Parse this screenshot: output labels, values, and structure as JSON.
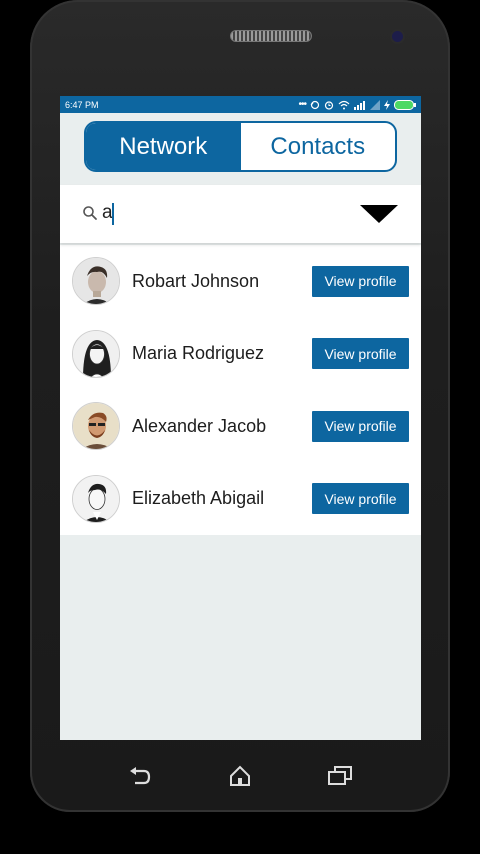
{
  "status_bar": {
    "time": "6:47 PM"
  },
  "tabs": [
    {
      "label": "Network",
      "active": true
    },
    {
      "label": "Contacts",
      "active": false
    }
  ],
  "search": {
    "value": "a"
  },
  "people": [
    {
      "name": "Robart Johnson",
      "button": "View profile"
    },
    {
      "name": "Maria Rodriguez",
      "button": "View profile"
    },
    {
      "name": "Alexander Jacob",
      "button": "View profile"
    },
    {
      "name": "Elizabeth Abigail",
      "button": "View profile"
    }
  ],
  "colors": {
    "accent": "#0d66a0",
    "background": "#e9eeee"
  },
  "icons": [
    "search-icon",
    "dropdown-icon",
    "back-icon",
    "home-icon",
    "recent-apps-icon"
  ]
}
